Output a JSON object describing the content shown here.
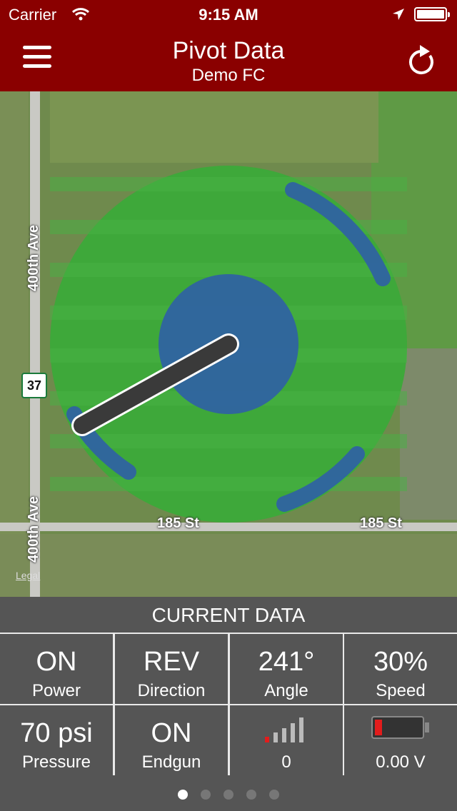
{
  "status_bar": {
    "carrier": "Carrier",
    "time": "9:15 AM"
  },
  "header": {
    "title": "Pivot Data",
    "subtitle": "Demo FC",
    "menu_icon": "hamburger-menu-icon",
    "refresh_icon": "refresh-icon"
  },
  "map": {
    "road_labels": [
      "400th Ave",
      "400th Ave",
      "185 St",
      "185 St"
    ],
    "shield_number": "37",
    "legal": "Legal",
    "pivot_angle_deg": 241,
    "colors": {
      "field": "#3ea83a",
      "pivot_zone": "#2f5fa6",
      "arm": "#3a3a3a"
    }
  },
  "current_data": {
    "title": "CURRENT DATA",
    "cells": [
      {
        "value": "ON",
        "label": "Power"
      },
      {
        "value": "REV",
        "label": "Direction"
      },
      {
        "value": "241°",
        "label": "Angle"
      },
      {
        "value": "30%",
        "label": "Speed"
      },
      {
        "value": "70 psi",
        "label": "Pressure"
      },
      {
        "value": "ON",
        "label": "Endgun"
      },
      {
        "value": "",
        "label": "0",
        "icon": "signal-strength-icon"
      },
      {
        "value": "",
        "label": "0.00 V",
        "icon": "battery-icon"
      }
    ]
  },
  "pager": {
    "page_count": 5,
    "active_index": 0
  },
  "accent_color": "#8a0000"
}
